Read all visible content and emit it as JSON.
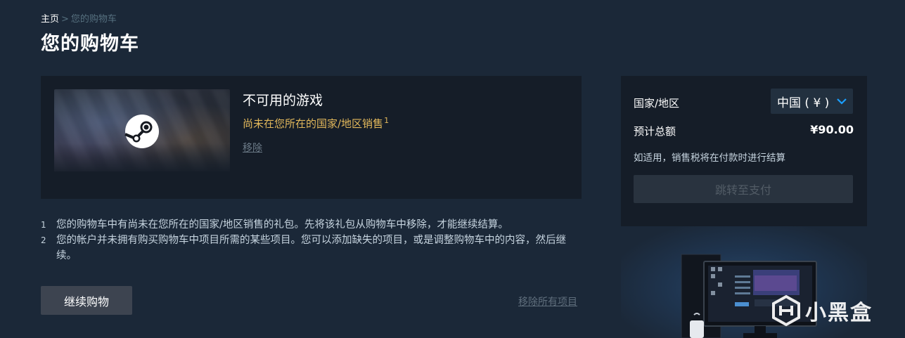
{
  "breadcrumb": {
    "home": "主页",
    "separator": ">",
    "current": "您的购物车"
  },
  "page_title": "您的购物车",
  "cart_item": {
    "title": "不可用的游戏",
    "warning": "尚未在您所在的国家/地区销售",
    "warning_footnote": "1",
    "remove_label": "移除",
    "capsule_icon": "steam-logo-icon"
  },
  "notes": [
    {
      "num": "1",
      "text": "您的购物车中有尚未在您所在的国家/地区销售的礼包。先将该礼包从购物车中移除，才能继续结算。"
    },
    {
      "num": "2",
      "text": "您的帐户并未拥有购买购物车中项目所需的某些项目。您可以添加缺失的项目，或是调整购物车中的内容，然后继续。"
    }
  ],
  "actions": {
    "continue_label": "继续购物",
    "remove_all_label": "移除所有项目"
  },
  "summary": {
    "region_label": "国家/地区",
    "region_value": "中国 ( ¥ )",
    "total_label": "预计总额",
    "total_value": "¥90.00",
    "tax_note": "如适用，销售税将在付款时进行结算",
    "pay_label": "跳转至支付"
  },
  "watermark": {
    "text": "小黑盒",
    "icon": "heybox-logo-icon"
  },
  "colors": {
    "background": "#1b2838",
    "panel": "#151d28",
    "warning": "#e2b85b",
    "dropdown_accent": "#1a9fff"
  }
}
